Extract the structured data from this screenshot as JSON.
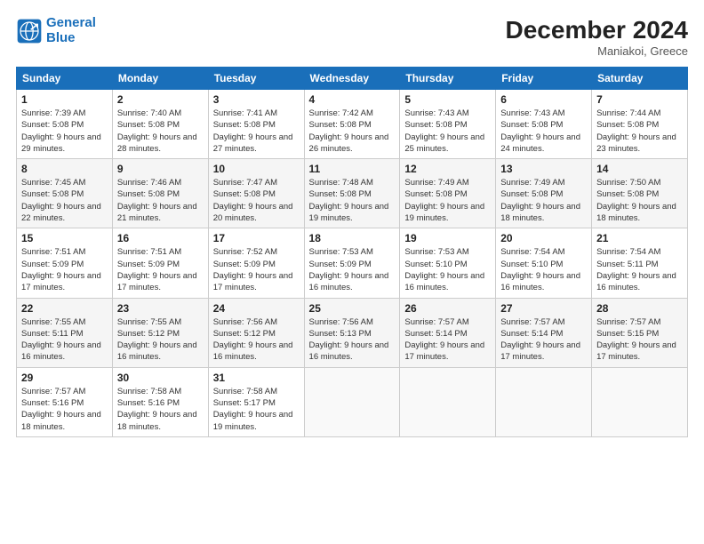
{
  "header": {
    "logo_line1": "General",
    "logo_line2": "Blue",
    "month_title": "December 2024",
    "location": "Maniakoi, Greece"
  },
  "days_of_week": [
    "Sunday",
    "Monday",
    "Tuesday",
    "Wednesday",
    "Thursday",
    "Friday",
    "Saturday"
  ],
  "weeks": [
    [
      {
        "day": "1",
        "sunrise": "7:39 AM",
        "sunset": "5:08 PM",
        "daylight": "9 hours and 29 minutes."
      },
      {
        "day": "2",
        "sunrise": "7:40 AM",
        "sunset": "5:08 PM",
        "daylight": "9 hours and 28 minutes."
      },
      {
        "day": "3",
        "sunrise": "7:41 AM",
        "sunset": "5:08 PM",
        "daylight": "9 hours and 27 minutes."
      },
      {
        "day": "4",
        "sunrise": "7:42 AM",
        "sunset": "5:08 PM",
        "daylight": "9 hours and 26 minutes."
      },
      {
        "day": "5",
        "sunrise": "7:43 AM",
        "sunset": "5:08 PM",
        "daylight": "9 hours and 25 minutes."
      },
      {
        "day": "6",
        "sunrise": "7:43 AM",
        "sunset": "5:08 PM",
        "daylight": "9 hours and 24 minutes."
      },
      {
        "day": "7",
        "sunrise": "7:44 AM",
        "sunset": "5:08 PM",
        "daylight": "9 hours and 23 minutes."
      }
    ],
    [
      {
        "day": "8",
        "sunrise": "7:45 AM",
        "sunset": "5:08 PM",
        "daylight": "9 hours and 22 minutes."
      },
      {
        "day": "9",
        "sunrise": "7:46 AM",
        "sunset": "5:08 PM",
        "daylight": "9 hours and 21 minutes."
      },
      {
        "day": "10",
        "sunrise": "7:47 AM",
        "sunset": "5:08 PM",
        "daylight": "9 hours and 20 minutes."
      },
      {
        "day": "11",
        "sunrise": "7:48 AM",
        "sunset": "5:08 PM",
        "daylight": "9 hours and 19 minutes."
      },
      {
        "day": "12",
        "sunrise": "7:49 AM",
        "sunset": "5:08 PM",
        "daylight": "9 hours and 19 minutes."
      },
      {
        "day": "13",
        "sunrise": "7:49 AM",
        "sunset": "5:08 PM",
        "daylight": "9 hours and 18 minutes."
      },
      {
        "day": "14",
        "sunrise": "7:50 AM",
        "sunset": "5:08 PM",
        "daylight": "9 hours and 18 minutes."
      }
    ],
    [
      {
        "day": "15",
        "sunrise": "7:51 AM",
        "sunset": "5:09 PM",
        "daylight": "9 hours and 17 minutes."
      },
      {
        "day": "16",
        "sunrise": "7:51 AM",
        "sunset": "5:09 PM",
        "daylight": "9 hours and 17 minutes."
      },
      {
        "day": "17",
        "sunrise": "7:52 AM",
        "sunset": "5:09 PM",
        "daylight": "9 hours and 17 minutes."
      },
      {
        "day": "18",
        "sunrise": "7:53 AM",
        "sunset": "5:09 PM",
        "daylight": "9 hours and 16 minutes."
      },
      {
        "day": "19",
        "sunrise": "7:53 AM",
        "sunset": "5:10 PM",
        "daylight": "9 hours and 16 minutes."
      },
      {
        "day": "20",
        "sunrise": "7:54 AM",
        "sunset": "5:10 PM",
        "daylight": "9 hours and 16 minutes."
      },
      {
        "day": "21",
        "sunrise": "7:54 AM",
        "sunset": "5:11 PM",
        "daylight": "9 hours and 16 minutes."
      }
    ],
    [
      {
        "day": "22",
        "sunrise": "7:55 AM",
        "sunset": "5:11 PM",
        "daylight": "9 hours and 16 minutes."
      },
      {
        "day": "23",
        "sunrise": "7:55 AM",
        "sunset": "5:12 PM",
        "daylight": "9 hours and 16 minutes."
      },
      {
        "day": "24",
        "sunrise": "7:56 AM",
        "sunset": "5:12 PM",
        "daylight": "9 hours and 16 minutes."
      },
      {
        "day": "25",
        "sunrise": "7:56 AM",
        "sunset": "5:13 PM",
        "daylight": "9 hours and 16 minutes."
      },
      {
        "day": "26",
        "sunrise": "7:57 AM",
        "sunset": "5:14 PM",
        "daylight": "9 hours and 17 minutes."
      },
      {
        "day": "27",
        "sunrise": "7:57 AM",
        "sunset": "5:14 PM",
        "daylight": "9 hours and 17 minutes."
      },
      {
        "day": "28",
        "sunrise": "7:57 AM",
        "sunset": "5:15 PM",
        "daylight": "9 hours and 17 minutes."
      }
    ],
    [
      {
        "day": "29",
        "sunrise": "7:57 AM",
        "sunset": "5:16 PM",
        "daylight": "9 hours and 18 minutes."
      },
      {
        "day": "30",
        "sunrise": "7:58 AM",
        "sunset": "5:16 PM",
        "daylight": "9 hours and 18 minutes."
      },
      {
        "day": "31",
        "sunrise": "7:58 AM",
        "sunset": "5:17 PM",
        "daylight": "9 hours and 19 minutes."
      },
      null,
      null,
      null,
      null
    ]
  ],
  "labels": {
    "sunrise_prefix": "Sunrise: ",
    "sunset_prefix": "Sunset: ",
    "daylight_prefix": "Daylight: "
  }
}
